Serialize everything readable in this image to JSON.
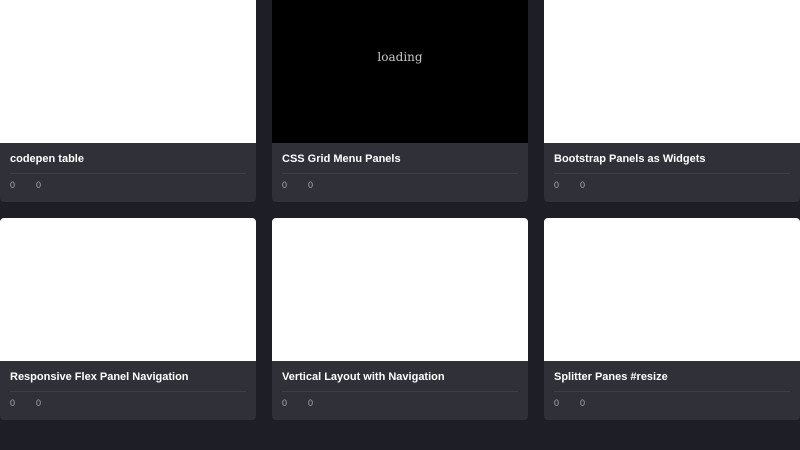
{
  "cards": [
    {
      "title": "codepen table",
      "loading": "",
      "stats": [
        "0",
        "0"
      ]
    },
    {
      "title": "CSS Grid Menu Panels",
      "loading": "loading",
      "stats": [
        "0",
        "0"
      ]
    },
    {
      "title": "Bootstrap Panels as Widgets",
      "loading": "",
      "stats": [
        "0",
        "0"
      ]
    },
    {
      "title": "Responsive Flex Panel Navigation",
      "loading": "",
      "stats": [
        "0",
        "0"
      ]
    },
    {
      "title": "Vertical Layout with Navigation",
      "loading": "",
      "stats": [
        "0",
        "0"
      ]
    },
    {
      "title": "Splitter Panes #resize",
      "loading": "",
      "stats": [
        "0",
        "0"
      ]
    }
  ],
  "colors": {
    "page_bg": "#1e1f26",
    "card_meta_bg": "#2f3038",
    "title_text": "#ffffff",
    "stat_text": "#a9abb4"
  }
}
